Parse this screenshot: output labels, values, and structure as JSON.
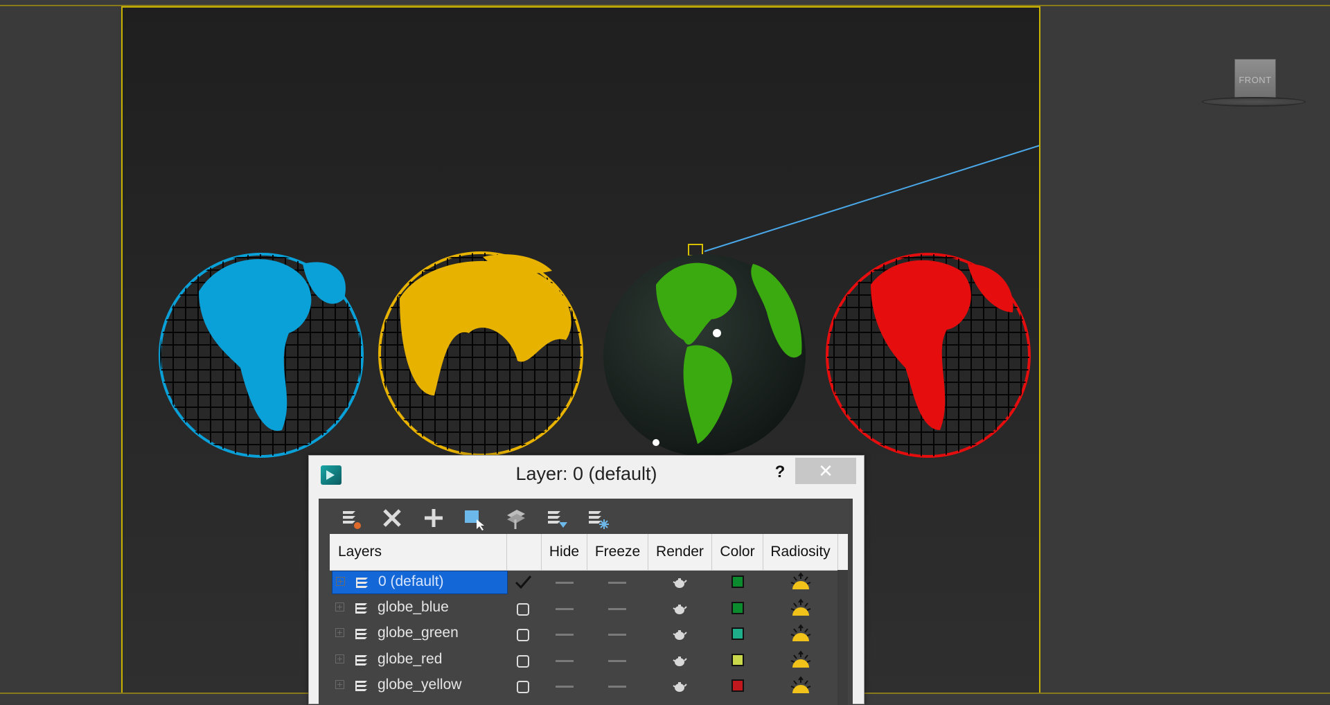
{
  "viewcube": {
    "label": "FRONT"
  },
  "dialog": {
    "title": "Layer: 0 (default)",
    "help_label": "?",
    "close_label": "✕",
    "toolbar": [
      {
        "name": "create-new-layer-icon"
      },
      {
        "name": "delete-layer-icon"
      },
      {
        "name": "add-to-layer-icon"
      },
      {
        "name": "select-objects-icon"
      },
      {
        "name": "highlight-selected-icon"
      },
      {
        "name": "hide-all-layers-icon"
      },
      {
        "name": "freeze-all-layers-icon"
      }
    ],
    "columns": {
      "layers": "Layers",
      "hide": "Hide",
      "freeze": "Freeze",
      "render": "Render",
      "color": "Color",
      "radiosity": "Radiosity"
    },
    "rows": [
      {
        "name": "0 (default)",
        "active": true,
        "selected": true,
        "color": "#0b8a2e"
      },
      {
        "name": "globe_blue",
        "active": false,
        "selected": false,
        "color": "#0b8a2e"
      },
      {
        "name": "globe_green",
        "active": false,
        "selected": false,
        "color": "#1fae8a"
      },
      {
        "name": "globe_red",
        "active": false,
        "selected": false,
        "color": "#c9d84a"
      },
      {
        "name": "globe_yellow",
        "active": false,
        "selected": false,
        "color": "#c0181c"
      }
    ]
  },
  "colors": {
    "globe_blue": "#0aa0d8",
    "globe_yellow": "#e8b300",
    "globe_green": "#3aaa10",
    "globe_red": "#e50d0d",
    "viewport_border": "#c8b400",
    "selection": "#1467d6"
  }
}
